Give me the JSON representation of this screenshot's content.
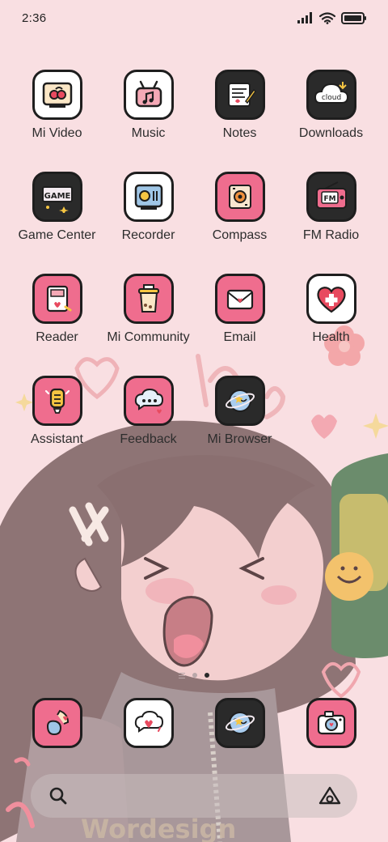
{
  "status_bar": {
    "time": "2:36",
    "icons": [
      "signal-icon",
      "wifi-icon",
      "battery-icon"
    ]
  },
  "apps": [
    {
      "label": "Mi Video",
      "icon": "mi-video-icon",
      "style": "light"
    },
    {
      "label": "Music",
      "icon": "music-icon",
      "style": "light"
    },
    {
      "label": "Notes",
      "icon": "notes-icon",
      "style": "dark"
    },
    {
      "label": "Downloads",
      "icon": "downloads-icon",
      "style": "dark"
    },
    {
      "label": "Game Center",
      "icon": "game-center-icon",
      "style": "dark"
    },
    {
      "label": "Recorder",
      "icon": "recorder-icon",
      "style": "light"
    },
    {
      "label": "Compass",
      "icon": "compass-icon",
      "style": "pink"
    },
    {
      "label": "FM Radio",
      "icon": "fm-radio-icon",
      "style": "dark"
    },
    {
      "label": "Reader",
      "icon": "reader-icon",
      "style": "pink"
    },
    {
      "label": "Mi Community",
      "icon": "mi-community-icon",
      "style": "pink"
    },
    {
      "label": "Email",
      "icon": "email-icon",
      "style": "pink"
    },
    {
      "label": "Health",
      "icon": "health-icon",
      "style": "light"
    },
    {
      "label": "Assistant",
      "icon": "assistant-icon",
      "style": "pink"
    },
    {
      "label": "Feedback",
      "icon": "feedback-icon",
      "style": "pink"
    },
    {
      "label": "Mi Browser",
      "icon": "mi-browser-icon",
      "style": "dark"
    }
  ],
  "app_icon_text": {
    "downloads": "cloud",
    "game_center": "GAME",
    "fm_radio": "FM"
  },
  "page_indicator": {
    "pages": 2,
    "active": 2
  },
  "dock": [
    {
      "icon": "phone-icon",
      "style": "pink"
    },
    {
      "icon": "messages-icon",
      "style": "light"
    },
    {
      "icon": "browser-icon",
      "style": "dark"
    },
    {
      "icon": "camera-icon",
      "style": "pink"
    }
  ],
  "search_bar": {
    "left_icon": "search-icon",
    "right_icon": "assistant-triangle-icon"
  },
  "wallpaper": {
    "text": "Wordesign",
    "description_color": "#f9dfe2"
  },
  "colors": {
    "background": "#f9dfe2",
    "tile_pink": "#ef6d8e",
    "tile_dark": "#2a2a2a",
    "tile_light": "#ffffff",
    "outline": "#1e1e1e"
  }
}
